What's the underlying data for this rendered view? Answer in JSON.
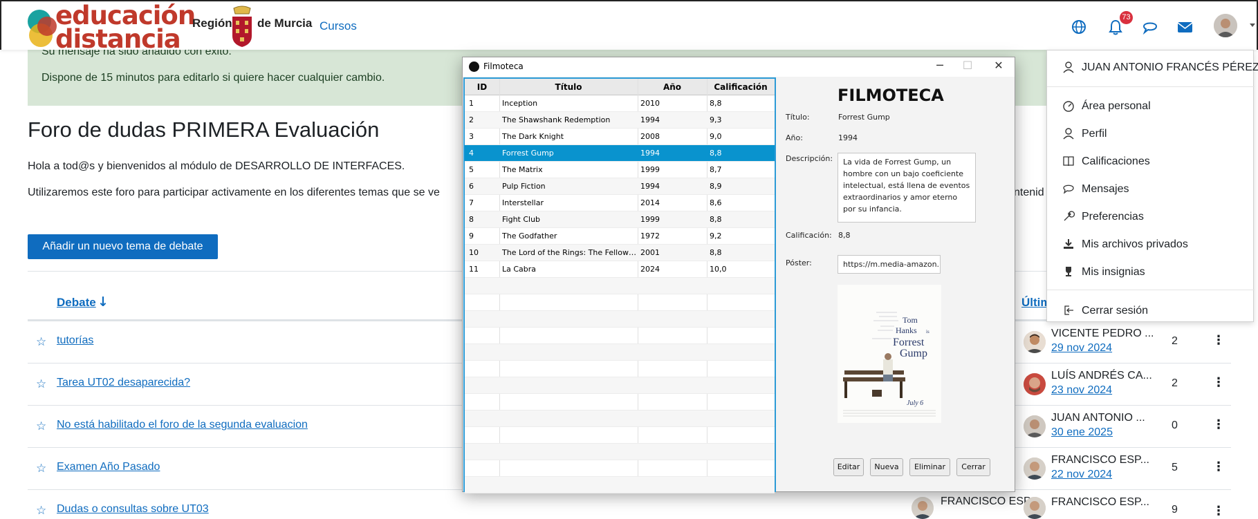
{
  "topbar": {
    "logo_line1": "educación",
    "logo_line2": "distancia",
    "region_a": "Región",
    "region_b": "de Murcia",
    "courses": "Cursos",
    "notifications_count": "73"
  },
  "alert": {
    "line1": "Su mensaje ha sido añadido con éxito.",
    "line2": "Dispone de 15 minutos para editarlo si quiere hacer cualquier cambio."
  },
  "forum": {
    "title": "Foro de dudas PRIMERA Evaluación",
    "intro1": "Hola a tod@s y bienvenidos al módulo de DESARROLLO DE INTERFACES.",
    "intro2": "Utilizaremos este foro para participar activamente en los diferentes temas que se ve",
    "intro2_tail": "ntenid",
    "new_topic": "Añadir un nuevo tema de debate",
    "col_debate": "Debate",
    "col_last": "Últim",
    "rows": [
      {
        "title": "tutorías",
        "user": "VICENTE PEDRO ...",
        "date": "29 nov 2024",
        "count": "2"
      },
      {
        "title": "Tarea UT02 desaparecida?",
        "user": "LUÍS ANDRÉS CA...",
        "date": "23 nov 2024",
        "count": "2"
      },
      {
        "title": "No está habilitado el foro de la segunda evaluacion",
        "user": "JUAN ANTONIO ...",
        "date": "30 ene 2025",
        "count": "0"
      },
      {
        "title": "Examen Año Pasado",
        "user": "FRANCISCO ESP...",
        "date": "22 nov 2024",
        "count": "5"
      },
      {
        "title": "Dudas o consultas sobre UT03",
        "user": "FRANCISCO ESP...",
        "date": "",
        "count": "9",
        "starter": "FRANCISCO ESP..."
      }
    ]
  },
  "user_menu": {
    "name": "JUAN ANTONIO FRANCÉS PÉREZ",
    "items": [
      "Área personal",
      "Perfil",
      "Calificaciones",
      "Mensajes",
      "Preferencias",
      "Mis archivos privados",
      "Mis insignias"
    ],
    "logout": "Cerrar sesión"
  },
  "window": {
    "title": "Filmoteca",
    "columns": [
      "ID",
      "Título",
      "Año",
      "Calificación"
    ],
    "films": [
      [
        "1",
        "Inception",
        "2010",
        "8,8"
      ],
      [
        "2",
        "The Shawshank Redemption",
        "1994",
        "9,3"
      ],
      [
        "3",
        "The Dark Knight",
        "2008",
        "9,0"
      ],
      [
        "4",
        "Forrest Gump",
        "1994",
        "8,8"
      ],
      [
        "5",
        "The Matrix",
        "1999",
        "8,7"
      ],
      [
        "6",
        "Pulp Fiction",
        "1994",
        "8,9"
      ],
      [
        "7",
        "Interstellar",
        "2014",
        "8,6"
      ],
      [
        "8",
        "Fight Club",
        "1999",
        "8,8"
      ],
      [
        "9",
        "The Godfather",
        "1972",
        "9,2"
      ],
      [
        "10",
        "The Lord of the Rings: The Fellows...",
        "2001",
        "8,8"
      ],
      [
        "11",
        "La Cabra",
        "2024",
        "10,0"
      ]
    ],
    "selected_index": 3,
    "detail": {
      "heading": "FILMOTECA",
      "title_label": "Título:",
      "title_value": "Forrest Gump",
      "year_label": "Año:",
      "year_value": "1994",
      "desc_label": "Descripción:",
      "desc_value": "La vida de Forrest Gump, un hombre con un bajo coeficiente intelectual, está llena de eventos extraordinarios y amor eterno por su infancia.",
      "rating_label": "Calificación:",
      "rating_value": "8,8",
      "poster_label": "Póster:",
      "poster_value": "https://m.media-amazon.",
      "poster_text1": "Tom",
      "poster_text2": "Hanks",
      "poster_text3": "is",
      "poster_text4": "Forrest",
      "poster_text5": "Gump",
      "poster_text6": "July 6"
    },
    "buttons": [
      "Editar",
      "Nueva",
      "Eliminar",
      "Cerrar"
    ]
  },
  "colors": {
    "accent": "#0f6cbf",
    "selection": "#0993ce",
    "alert_bg": "#d7e6d6"
  }
}
